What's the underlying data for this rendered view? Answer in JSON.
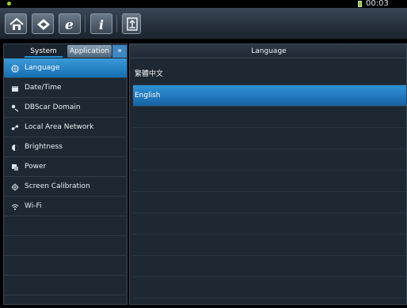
{
  "status_bar": {
    "time": "00:03",
    "battery_color": "#8bc34a"
  },
  "toolbar": {
    "buttons": [
      {
        "name": "home-icon"
      },
      {
        "name": "diagnose-icon"
      },
      {
        "name": "browser-icon"
      },
      {
        "name": "info-icon"
      },
      {
        "name": "exit-icon"
      }
    ]
  },
  "left_panel": {
    "tabs": [
      {
        "label": "System",
        "active": true
      },
      {
        "label": "Application",
        "active": false
      }
    ],
    "more_label": "»",
    "items": [
      {
        "label": "Language",
        "icon": "language-icon",
        "active": true
      },
      {
        "label": "Date/Time",
        "icon": "calendar-icon",
        "active": false
      },
      {
        "label": "DBScar Domain",
        "icon": "domain-icon",
        "active": false
      },
      {
        "label": "Local Area Network",
        "icon": "network-icon",
        "active": false
      },
      {
        "label": "Brightness",
        "icon": "brightness-icon",
        "active": false
      },
      {
        "label": "Power",
        "icon": "power-icon",
        "active": false
      },
      {
        "label": "Screen Calibration",
        "icon": "crosshair-icon",
        "active": false
      },
      {
        "label": "Wi-Fi",
        "icon": "wifi-icon",
        "active": false
      }
    ]
  },
  "right_panel": {
    "title": "Language",
    "options": [
      {
        "label": "繁體中文",
        "selected": false
      },
      {
        "label": "English",
        "selected": true
      }
    ]
  },
  "colors": {
    "accent": "#1e90d6",
    "selected_row": "#2f92d6",
    "panel_bg": "#1d2833"
  }
}
